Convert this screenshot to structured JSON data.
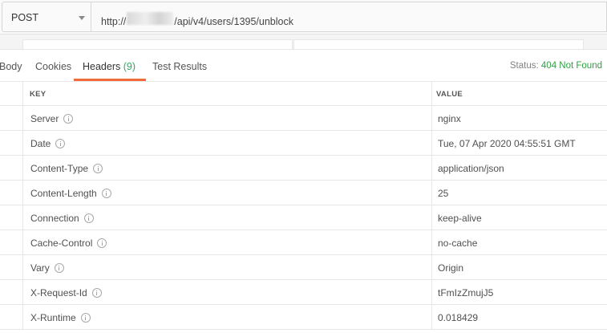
{
  "request": {
    "method": "POST",
    "url_prefix": "http://",
    "url_suffix": "/api/v4/users/1395/unblock"
  },
  "tabs": [
    {
      "label": "Body"
    },
    {
      "label": "Cookies"
    },
    {
      "label": "Headers",
      "count": "(9)",
      "active": true
    },
    {
      "label": "Test Results"
    }
  ],
  "status": {
    "label": "Status:",
    "value": "404 Not Found",
    "color": "#2ea043"
  },
  "accent_color": "#f26b3a",
  "table": {
    "key_header": "KEY",
    "value_header": "VALUE",
    "rows": [
      {
        "key": "Server",
        "value": "nginx"
      },
      {
        "key": "Date",
        "value": "Tue, 07 Apr 2020 04:55:51 GMT"
      },
      {
        "key": "Content-Type",
        "value": "application/json"
      },
      {
        "key": "Content-Length",
        "value": "25"
      },
      {
        "key": "Connection",
        "value": "keep-alive"
      },
      {
        "key": "Cache-Control",
        "value": "no-cache"
      },
      {
        "key": "Vary",
        "value": "Origin"
      },
      {
        "key": "X-Request-Id",
        "value": "tFmIzZmujJ5"
      },
      {
        "key": "X-Runtime",
        "value": "0.018429"
      }
    ]
  }
}
